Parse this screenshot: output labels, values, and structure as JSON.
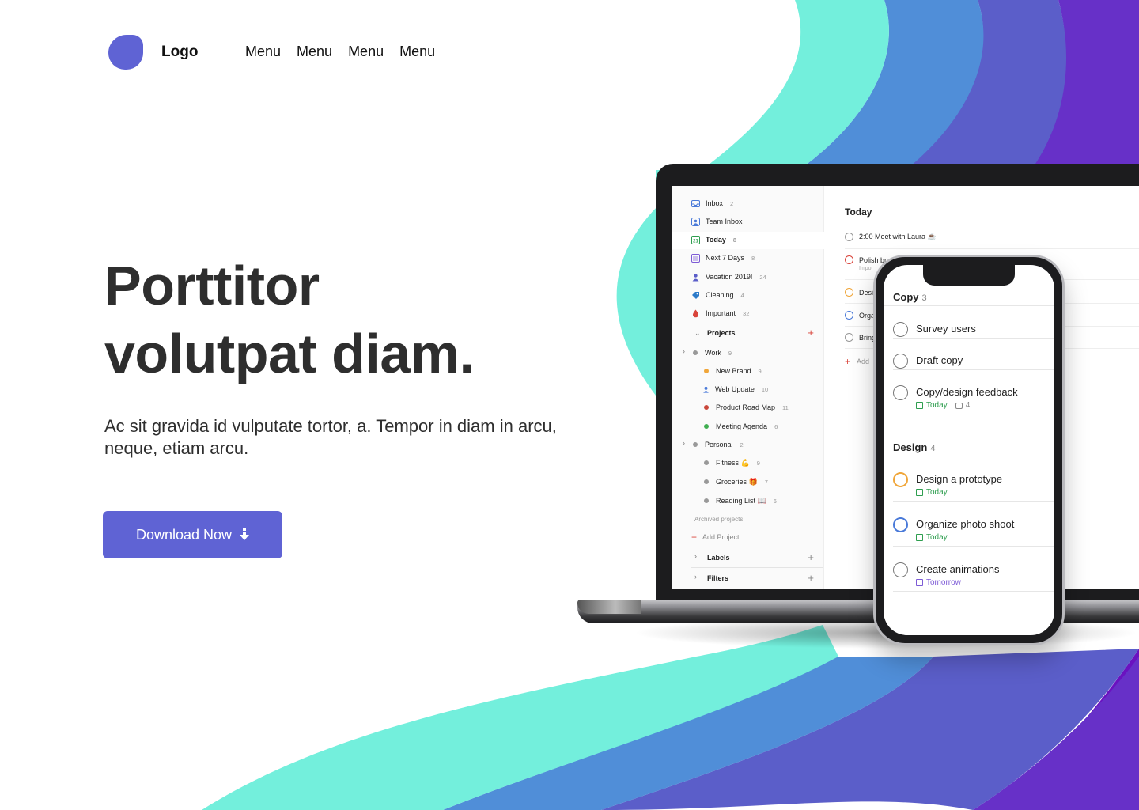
{
  "colors": {
    "accent": "#5f63d4",
    "wave_teal": "#73efdc",
    "wave_blue": "#508ed8",
    "wave_indigo": "#5b5ec9",
    "wave_purple": "#6730c8",
    "wave_violet": "#6a12c0"
  },
  "header": {
    "logo_text": "Logo",
    "menu": [
      "Menu",
      "Menu",
      "Menu",
      "Menu"
    ]
  },
  "hero": {
    "title_line1": "Porttitor",
    "title_line2": "volutpat diam.",
    "subtitle": "Ac sit gravida id vulputate tortor, a. Tempor in diam in arcu, neque, etiam arcu.",
    "cta_label": "Download Now",
    "cta_icon": "arrow-down-icon"
  },
  "laptop": {
    "sidebar": {
      "inbox": {
        "label": "Inbox",
        "count": "2"
      },
      "team_inbox": {
        "label": "Team Inbox"
      },
      "today": {
        "label": "Today",
        "count": "8"
      },
      "next7": {
        "label": "Next 7 Days",
        "count": "8"
      },
      "vacation": {
        "label": "Vacation 2019!",
        "count": "24"
      },
      "cleaning": {
        "label": "Cleaning",
        "count": "4"
      },
      "important": {
        "label": "Important",
        "count": "32"
      },
      "projects_label": "Projects",
      "work": {
        "label": "Work",
        "count": "9"
      },
      "new_brand": {
        "label": "New Brand",
        "count": "9"
      },
      "web_update": {
        "label": "Web Update",
        "count": "10"
      },
      "road_map": {
        "label": "Product Road Map",
        "count": "11"
      },
      "meeting": {
        "label": "Meeting Agenda",
        "count": "6"
      },
      "personal": {
        "label": "Personal",
        "count": "2"
      },
      "fitness": {
        "label": "Fitness 💪",
        "count": "9"
      },
      "groceries": {
        "label": "Groceries 🎁",
        "count": "7"
      },
      "reading": {
        "label": "Reading List 📖",
        "count": "6"
      },
      "archived": "Archived projects",
      "add_project": "Add Project",
      "labels": "Labels",
      "filters": "Filters"
    },
    "main": {
      "title": "Today",
      "tasks": [
        "2:00 Meet with Laura ☕",
        "Polish br",
        "Desi",
        "Orga",
        "Bring"
      ],
      "polish_sub": "Impor",
      "add_task": "Add"
    }
  },
  "phone": {
    "copy_section": {
      "label": "Copy",
      "count": "3"
    },
    "copy_tasks": [
      {
        "label": "Survey users"
      },
      {
        "label": "Draft copy"
      },
      {
        "label": "Copy/design feedback",
        "due": "Today",
        "comments": "4"
      }
    ],
    "design_section": {
      "label": "Design",
      "count": "4"
    },
    "design_tasks": [
      {
        "label": "Design a prototype",
        "due": "Today"
      },
      {
        "label": "Organize photo shoot",
        "due": "Today"
      },
      {
        "label": "Create animations",
        "due": "Tomorrow"
      }
    ]
  }
}
